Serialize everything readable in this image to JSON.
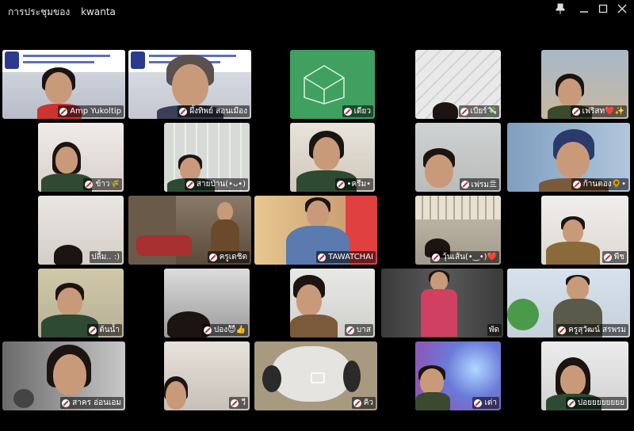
{
  "window": {
    "title": "การประชุมของ",
    "owner": "kwanta"
  },
  "participants": [
    "Amp Yukoltip",
    "ผึ้งทิพย์ สอนเมือง",
    "เดียว",
    "เบียร์💸",
    "เฟริสท❤️✨",
    "ข้าว🌾",
    "สายป่าน(•ᴗ•)",
    "•ครีม•",
    "เฟรม亖",
    "ก้านตอง🌻•",
    "ปลื้ม.. :)",
    "ครูเดชิต",
    "TAWATCHAI",
    "วุ้นเส้น(•‿•)❤️",
    "พีช",
    "ต้นน้ำ",
    "ปอง😈👍",
    "บาส",
    "พัด",
    "ครูสุวัฒน์ สรพรม",
    "สาคร อ่อนเอม",
    "วี",
    "คิว",
    "เต่า",
    "ปอยยยยยยยย"
  ]
}
